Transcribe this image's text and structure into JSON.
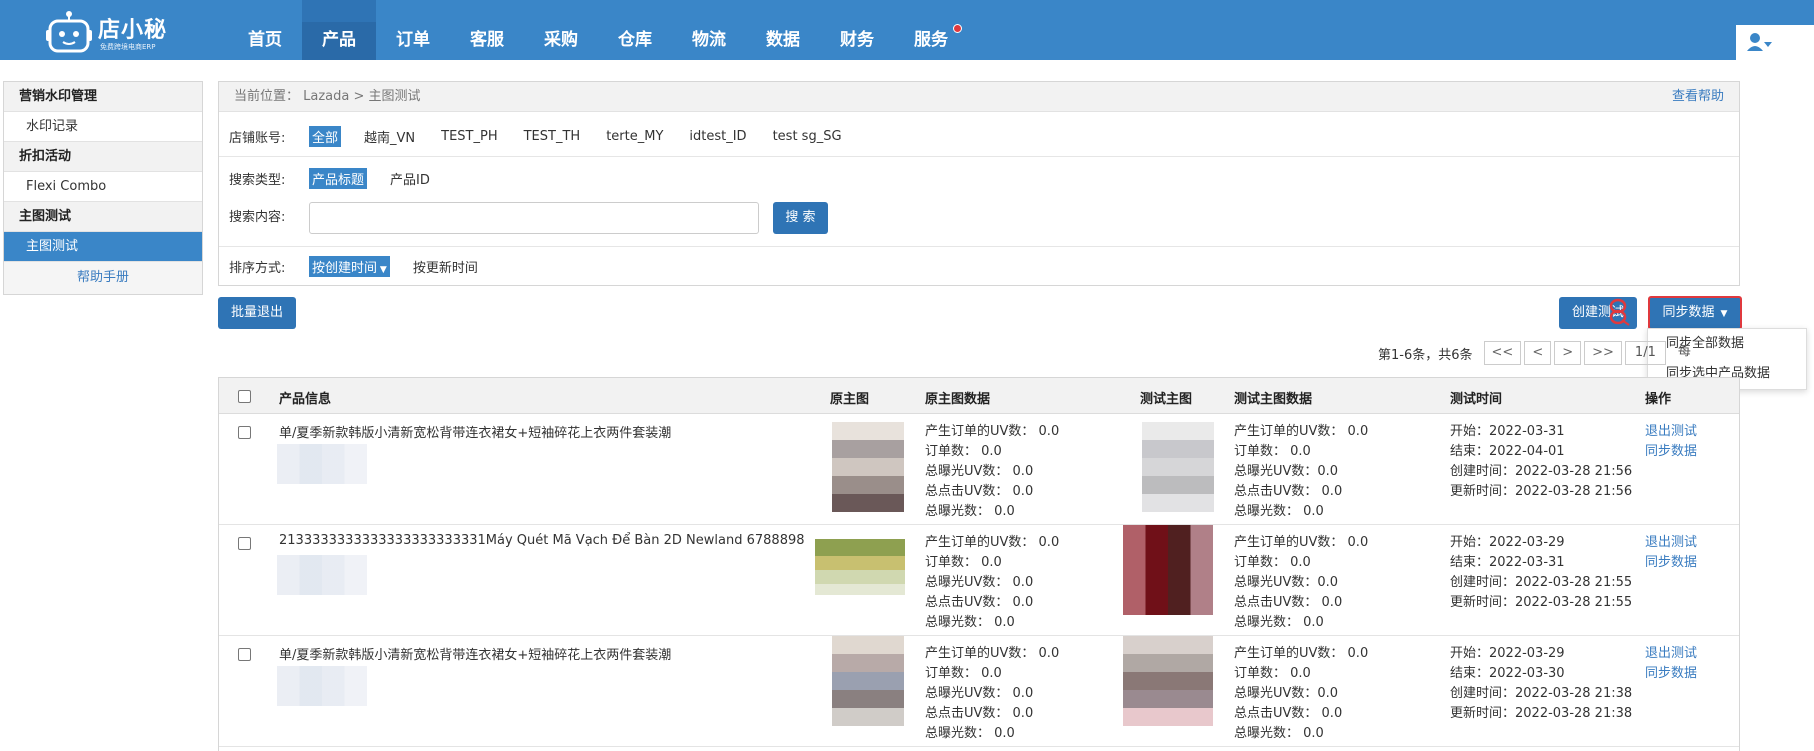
{
  "brand": {
    "name": "店小秘",
    "tagline": "免费跨境电商ERP"
  },
  "nav": [
    {
      "label": "首页",
      "active": false
    },
    {
      "label": "产品",
      "active": true
    },
    {
      "label": "订单",
      "active": false
    },
    {
      "label": "客服",
      "active": false
    },
    {
      "label": "采购",
      "active": false
    },
    {
      "label": "仓库",
      "active": false
    },
    {
      "label": "物流",
      "active": false
    },
    {
      "label": "数据",
      "active": false
    },
    {
      "label": "财务",
      "active": false
    },
    {
      "label": "服务",
      "active": false,
      "dot": true
    }
  ],
  "sidebar": {
    "group1": "营销水印管理",
    "item1": "水印记录",
    "group2": "折扣活动",
    "item2": "Flexi Combo",
    "group3": "主图测试",
    "item3": "主图测试",
    "help": "帮助手册"
  },
  "breadcrumb": {
    "text": "当前位置： Lazada > 主图测试",
    "help": "查看帮助"
  },
  "filters": {
    "store_label": "店铺账号:",
    "stores": [
      "全部",
      "越南_VN",
      "TEST_PH",
      "TEST_TH",
      "terte_MY",
      "idtest_ID",
      "test sg_SG"
    ],
    "type_label": "搜索类型:",
    "types": [
      "产品标题",
      "产品ID"
    ],
    "content_label": "搜索内容:",
    "search_value": "",
    "search_button": "搜 索",
    "sort_label": "排序方式:",
    "sort_options": [
      "按创建时间",
      "按更新时间"
    ]
  },
  "toolbar": {
    "batch_exit": "批量退出",
    "create_test": "创建测试",
    "sync_data": "同步数据",
    "sync_menu": [
      "同步全部数据",
      "同步选中产品数据"
    ]
  },
  "pager": {
    "summary": "第1-6条，共6条",
    "first": "<<",
    "prev": "<",
    "next": ">",
    "last": ">>",
    "page": "1/1",
    "per_page": "每"
  },
  "table": {
    "headers": [
      "产品信息",
      "原主图",
      "原主图数据",
      "测试主图",
      "测试主图数据",
      "测试时间",
      "操作"
    ],
    "rows": [
      {
        "name": "单/夏季新款韩版小清新宽松背带连衣裙女+短袖碎花上衣两件套装潮",
        "orig_stats": [
          "产生订单的UV数： 0.0",
          "订单数： 0.0",
          "总曝光UV数： 0.0",
          "总点击UV数： 0.0",
          "总曝光数： 0.0"
        ],
        "test_stats": [
          "产生订单的UV数： 0.0",
          "订单数： 0.0",
          "总曝光UV数：0.0",
          "总点击UV数： 0.0",
          "总曝光数： 0.0"
        ],
        "times": [
          "开始：2022-03-31",
          "结束：2022-04-01",
          "创建时间：2022-03-28 21:56",
          "更新时间：2022-03-28 21:56"
        ],
        "actions": [
          "退出测试",
          "同步数据"
        ]
      },
      {
        "name": "2133333333333333333333331Máy Quét Mã Vạch Để Bàn 2D Newland 6788898",
        "orig_stats": [
          "产生订单的UV数： 0.0",
          "订单数： 0.0",
          "总曝光UV数： 0.0",
          "总点击UV数： 0.0",
          "总曝光数： 0.0"
        ],
        "test_stats": [
          "产生订单的UV数： 0.0",
          "订单数： 0.0",
          "总曝光UV数：0.0",
          "总点击UV数： 0.0",
          "总曝光数： 0.0"
        ],
        "times": [
          "开始：2022-03-29",
          "结束：2022-03-31",
          "创建时间：2022-03-28 21:55",
          "更新时间：2022-03-28 21:55"
        ],
        "actions": [
          "退出测试",
          "同步数据"
        ]
      },
      {
        "name": "单/夏季新款韩版小清新宽松背带连衣裙女+短袖碎花上衣两件套装潮",
        "orig_stats": [
          "产生订单的UV数： 0.0",
          "订单数： 0.0",
          "总曝光UV数： 0.0",
          "总点击UV数： 0.0",
          "总曝光数： 0.0"
        ],
        "test_stats": [
          "产生订单的UV数： 0.0",
          "订单数： 0.0",
          "总曝光UV数：0.0",
          "总点击UV数： 0.0",
          "总曝光数： 0.0"
        ],
        "times": [
          "开始：2022-03-29",
          "结束：2022-03-30",
          "创建时间：2022-03-28 21:38",
          "更新时间：2022-03-28 21:38"
        ],
        "actions": [
          "退出测试",
          "同步数据"
        ]
      }
    ]
  }
}
